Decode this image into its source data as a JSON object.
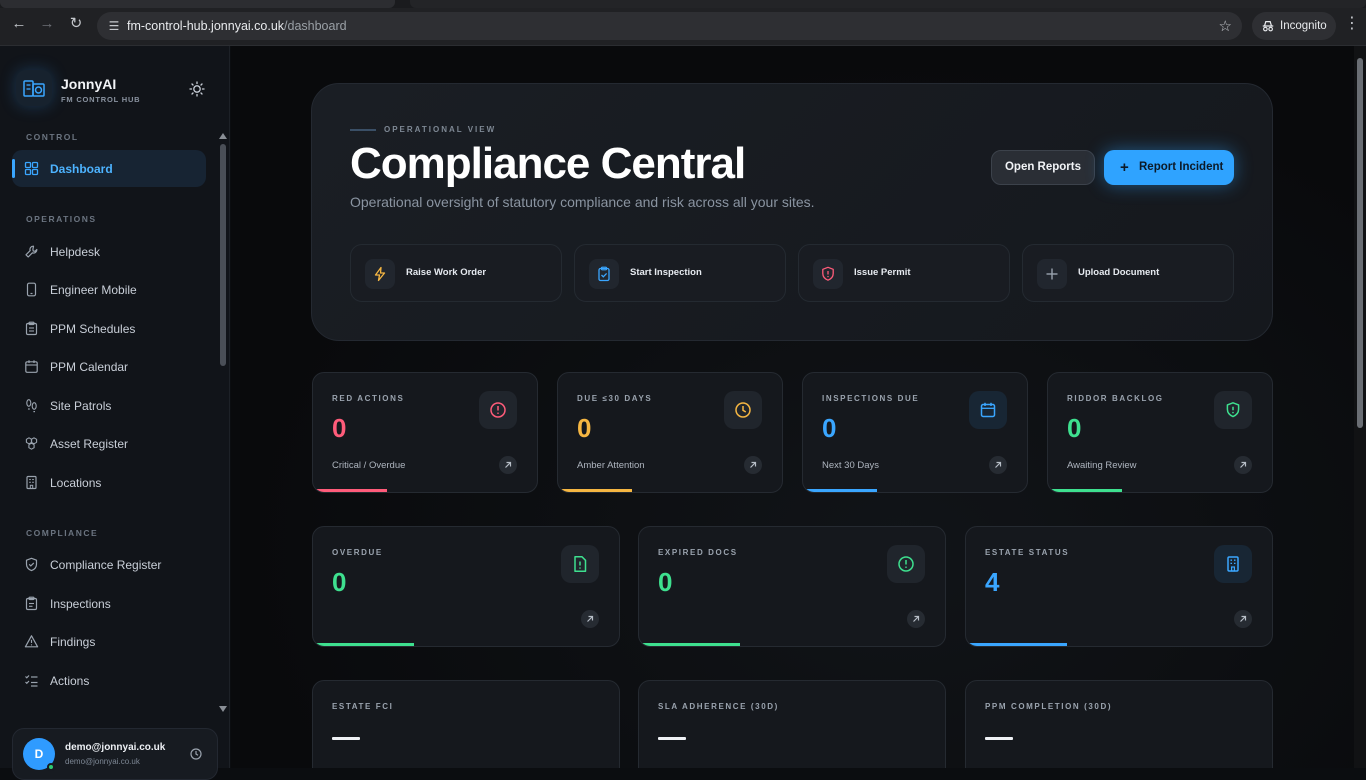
{
  "browser": {
    "url_host": "fm-control-hub.jonnyai.co.uk",
    "url_path": "/dashboard",
    "incognito_label": "Incognito"
  },
  "sidebar": {
    "brand_name": "JonnyAI",
    "brand_sub": "FM CONTROL HUB",
    "sections": {
      "control": "CONTROL",
      "operations": "OPERATIONS",
      "compliance": "COMPLIANCE"
    },
    "items": [
      {
        "label": "Dashboard",
        "icon": "grid-icon",
        "active": true
      },
      {
        "label": "Helpdesk",
        "icon": "wrench-icon"
      },
      {
        "label": "Engineer Mobile",
        "icon": "phone-icon"
      },
      {
        "label": "PPM Schedules",
        "icon": "clipboard-list-icon"
      },
      {
        "label": "PPM Calendar",
        "icon": "calendar-icon"
      },
      {
        "label": "Site Patrols",
        "icon": "footsteps-icon"
      },
      {
        "label": "Asset Register",
        "icon": "boxes-icon"
      },
      {
        "label": "Locations",
        "icon": "building-icon"
      },
      {
        "label": "Compliance Register",
        "icon": "shield-check-icon"
      },
      {
        "label": "Inspections",
        "icon": "clipboard-icon"
      },
      {
        "label": "Findings",
        "icon": "alert-triangle-icon"
      },
      {
        "label": "Actions",
        "icon": "list-checks-icon"
      }
    ],
    "user": {
      "initial": "D",
      "email": "demo@jonnyai.co.uk",
      "sub": "demo@jonnyai.co.uk"
    }
  },
  "hero": {
    "eyebrow": "OPERATIONAL VIEW",
    "title": "Compliance Central",
    "subtitle": "Operational oversight of statutory compliance and risk across all your sites.",
    "btn_reports": "Open Reports",
    "btn_incident": "Report Incident",
    "quick_actions": [
      {
        "label": "Raise Work Order",
        "icon": "bolt-icon",
        "color": "#f5b642"
      },
      {
        "label": "Start Inspection",
        "icon": "clipboard-check-icon",
        "color": "#3aa6ff"
      },
      {
        "label": "Issue Permit",
        "icon": "shield-alert-icon",
        "color": "#ff5c7a"
      },
      {
        "label": "Upload Document",
        "icon": "plus-icon",
        "color": "#9aa3ae"
      }
    ]
  },
  "stats_row1": [
    {
      "label": "RED ACTIONS",
      "value": "0",
      "caption": "Critical / Overdue",
      "color": "#ff5c7a",
      "icon": "alert-circle-icon",
      "progress": 0.33
    },
    {
      "label": "DUE ≤30 DAYS",
      "value": "0",
      "caption": "Amber Attention",
      "color": "#f5b642",
      "icon": "clock-icon",
      "progress": 0.33
    },
    {
      "label": "INSPECTIONS DUE",
      "value": "0",
      "caption": "Next 30 Days",
      "color": "#3aa6ff",
      "icon": "calendar-icon",
      "progress": 0.33
    },
    {
      "label": "RIDDOR BACKLOG",
      "value": "0",
      "caption": "Awaiting Review",
      "color": "#3ee08f",
      "icon": "shield-alert-icon",
      "progress": 0.33
    }
  ],
  "stats_row2": [
    {
      "label": "OVERDUE",
      "value": "0",
      "color": "#3ee08f",
      "icon": "file-alert-icon",
      "progress": 0.33
    },
    {
      "label": "EXPIRED DOCS",
      "value": "0",
      "color": "#3ee08f",
      "icon": "alert-circle-icon",
      "progress": 0.33
    },
    {
      "label": "ESTATE STATUS",
      "value": "4",
      "color": "#3aa6ff",
      "icon": "building-icon",
      "progress": 0.33
    }
  ],
  "stats_row3": [
    {
      "label": "ESTATE FCI"
    },
    {
      "label": "SLA ADHERENCE (30D)"
    },
    {
      "label": "PPM COMPLETION (30D)"
    }
  ]
}
